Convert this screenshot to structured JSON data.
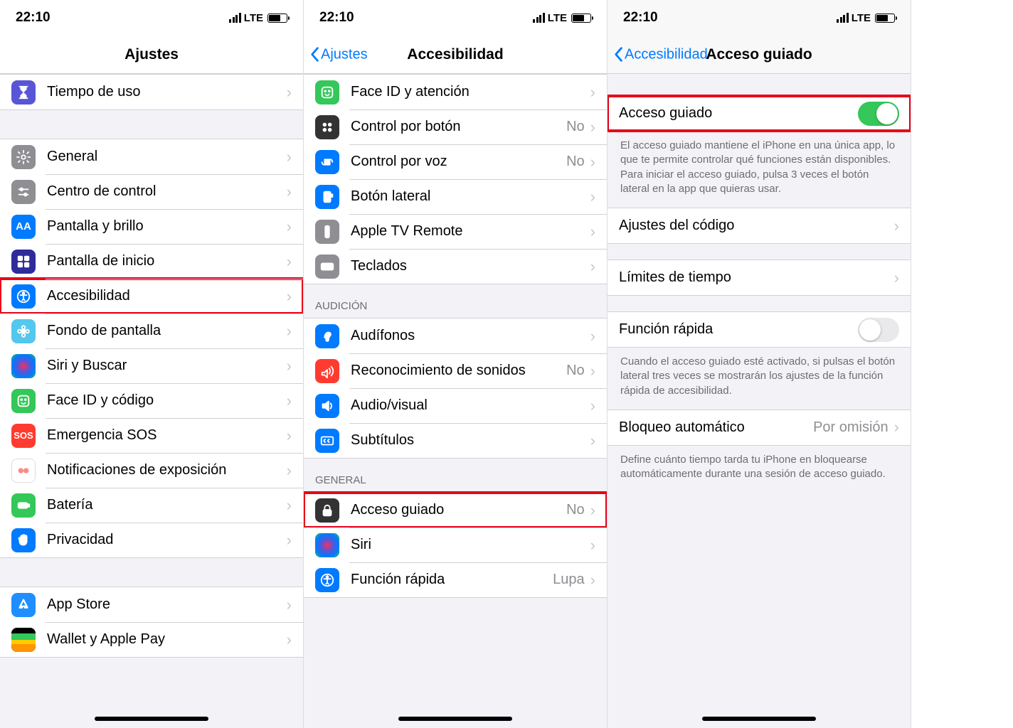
{
  "status": {
    "time": "22:10",
    "network": "LTE"
  },
  "screen1": {
    "title": "Ajustes",
    "groups": [
      [
        {
          "name": "tiempo-uso",
          "label": "Tiempo de uso",
          "iconBg": "#5856d6",
          "glyph": "hourglass"
        }
      ],
      [
        {
          "name": "general",
          "label": "General",
          "iconBg": "#8e8e93",
          "glyph": "gear"
        },
        {
          "name": "centro-control",
          "label": "Centro de control",
          "iconBg": "#8e8e93",
          "glyph": "sliders"
        },
        {
          "name": "pantalla-brillo",
          "label": "Pantalla y brillo",
          "iconBg": "#007aff",
          "glyph": "AA"
        },
        {
          "name": "pantalla-inicio",
          "label": "Pantalla de inicio",
          "iconBg": "#2e2b9b",
          "glyph": "grid"
        },
        {
          "name": "accesibilidad",
          "label": "Accesibilidad",
          "iconBg": "#007aff",
          "glyph": "access",
          "highlight": true
        },
        {
          "name": "fondo-pantalla",
          "label": "Fondo de pantalla",
          "iconBg": "#54c7ec",
          "glyph": "flower"
        },
        {
          "name": "siri-buscar",
          "label": "Siri y Buscar",
          "iconBg": "#000",
          "glyph": "siri"
        },
        {
          "name": "faceid-codigo",
          "label": "Face ID y código",
          "iconBg": "#34c759",
          "glyph": "face"
        },
        {
          "name": "emergencia-sos",
          "label": "Emergencia SOS",
          "iconBg": "#ff3b30",
          "glyph": "SOS"
        },
        {
          "name": "notif-expo",
          "label": "Notificaciones de exposición",
          "iconBg": "#fff",
          "glyph": "expo"
        },
        {
          "name": "bateria",
          "label": "Batería",
          "iconBg": "#34c759",
          "glyph": "battery"
        },
        {
          "name": "privacidad",
          "label": "Privacidad",
          "iconBg": "#007aff",
          "glyph": "hand"
        }
      ],
      [
        {
          "name": "app-store",
          "label": "App Store",
          "iconBg": "#1f8fff",
          "glyph": "appstore"
        },
        {
          "name": "wallet",
          "label": "Wallet y Apple Pay",
          "iconBg": "#000",
          "glyph": "wallet"
        }
      ]
    ]
  },
  "screen2": {
    "back": "Ajustes",
    "title": "Accesibilidad",
    "groups": [
      {
        "header": null,
        "rows": [
          {
            "name": "faceid-atencion",
            "label": "Face ID y atención",
            "iconBg": "#34c759",
            "glyph": "face"
          },
          {
            "name": "control-boton",
            "label": "Control por botón",
            "iconBg": "#333",
            "glyph": "grid4",
            "detail": "No"
          },
          {
            "name": "control-voz",
            "label": "Control por voz",
            "iconBg": "#007aff",
            "glyph": "voice",
            "detail": "No"
          },
          {
            "name": "boton-lateral",
            "label": "Botón lateral",
            "iconBg": "#007aff",
            "glyph": "side"
          },
          {
            "name": "apple-tv-remote",
            "label": "Apple TV Remote",
            "iconBg": "#8e8e93",
            "glyph": "remote"
          },
          {
            "name": "teclados",
            "label": "Teclados",
            "iconBg": "#8e8e93",
            "glyph": "keyboard"
          }
        ]
      },
      {
        "header": "AUDICIÓN",
        "rows": [
          {
            "name": "audifonos",
            "label": "Audífonos",
            "iconBg": "#007aff",
            "glyph": "ear"
          },
          {
            "name": "reconocimiento-sonidos",
            "label": "Reconocimiento de sonidos",
            "iconBg": "#ff3b30",
            "glyph": "sound",
            "detail": "No"
          },
          {
            "name": "audio-visual",
            "label": "Audio/visual",
            "iconBg": "#007aff",
            "glyph": "speaker"
          },
          {
            "name": "subtitulos",
            "label": "Subtítulos",
            "iconBg": "#007aff",
            "glyph": "cc"
          }
        ]
      },
      {
        "header": "GENERAL",
        "rows": [
          {
            "name": "acceso-guiado",
            "label": "Acceso guiado",
            "iconBg": "#333",
            "glyph": "lock",
            "detail": "No",
            "highlight": true
          },
          {
            "name": "siri",
            "label": "Siri",
            "iconBg": "#000",
            "glyph": "siri"
          },
          {
            "name": "funcion-rapida",
            "label": "Función rápida",
            "iconBg": "#007aff",
            "glyph": "access",
            "detail": "Lupa"
          }
        ]
      }
    ]
  },
  "screen3": {
    "back": "Accesibilidad",
    "title": "Acceso guiado",
    "rows": [
      {
        "type": "toggle",
        "name": "acceso-guiado-toggle",
        "label": "Acceso guiado",
        "on": true,
        "highlight": true
      },
      {
        "type": "footer",
        "text": "El acceso guiado mantiene el iPhone en una única app, lo que te permite controlar qué funciones están disponibles. Para iniciar el acceso guiado, pulsa 3 veces el botón lateral en la app que quieras usar."
      },
      {
        "type": "nav",
        "name": "ajustes-codigo",
        "label": "Ajustes del código"
      },
      {
        "type": "spacer"
      },
      {
        "type": "nav",
        "name": "limites-tiempo",
        "label": "Límites de tiempo"
      },
      {
        "type": "spacer"
      },
      {
        "type": "toggle",
        "name": "funcion-rapida-toggle",
        "label": "Función rápida",
        "on": false
      },
      {
        "type": "footer",
        "text": "Cuando el acceso guiado esté activado, si pulsas el botón lateral tres veces se mostrarán los ajustes de la función rápida de accesibilidad."
      },
      {
        "type": "nav",
        "name": "bloqueo-automatico",
        "label": "Bloqueo automático",
        "detail": "Por omisión"
      },
      {
        "type": "footer",
        "text": "Define cuánto tiempo tarda tu iPhone en bloquearse automáticamente durante una sesión de acceso guiado."
      }
    ]
  }
}
